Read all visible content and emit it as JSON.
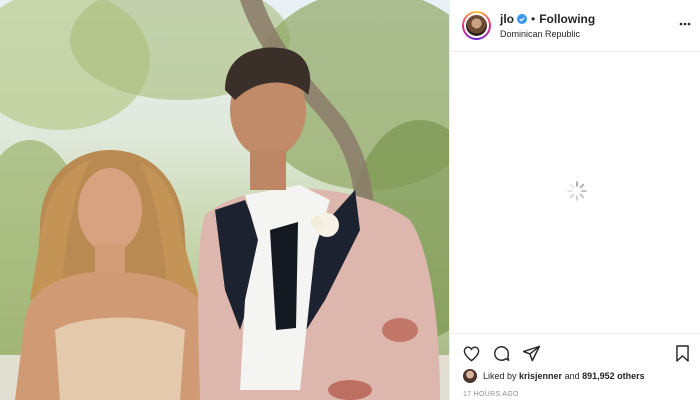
{
  "post": {
    "image_alt": "photo"
  },
  "header": {
    "username": "jlo",
    "separator": "•",
    "follow_status": "Following",
    "location": "Dominican Republic"
  },
  "icons": {
    "verified": "verified-badge-icon",
    "more": "more-options-icon",
    "loading": "loading-spinner-icon",
    "like": "heart-icon",
    "comment": "comment-icon",
    "share": "share-icon",
    "save": "bookmark-icon"
  },
  "engagement": {
    "liked_by_prefix": "Liked by ",
    "liked_by_user": "krisjenner",
    "liked_by_middle": " and ",
    "likes_count": "891,952 others"
  },
  "timestamp": "17 HOURS AGO",
  "colors": {
    "verified_blue": "#3897f0",
    "text": "#262626",
    "muted": "#8e8e8e",
    "border": "#efefef"
  }
}
